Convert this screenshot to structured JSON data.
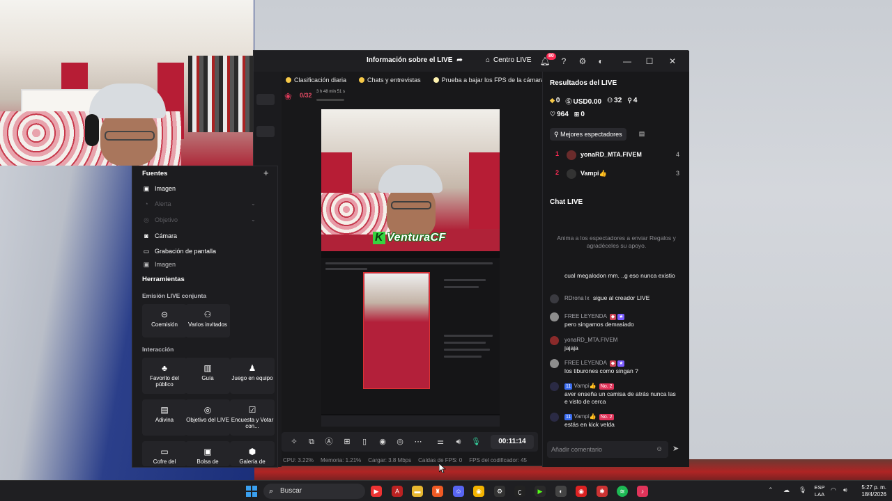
{
  "window": {
    "title": "Información sobre el LIVE",
    "center_label": "Centro LIVE",
    "notif_count": "80"
  },
  "tabs": [
    {
      "label": "Clasificación diaria"
    },
    {
      "label": "Chats y entrevistas"
    },
    {
      "label": "Prueba a bajar los FPS de la cámara"
    }
  ],
  "goal": {
    "count": "0/32",
    "time": "3 h 48 min 51 s"
  },
  "preview": {
    "overlay_text": "VenturaCF",
    "overlay_badge": "K"
  },
  "controls": {
    "timer": "00:11:14"
  },
  "stats": {
    "cpu": "CPU: 3.22%",
    "memory": "Memoria: 1.21%",
    "load": "Cargar: 3.8 Mbps",
    "fps_drop": "Caídas de FPS: 0",
    "encoder_fps": "FPS del codificador: 45"
  },
  "results": {
    "title": "Resultados del LIVE",
    "row1": {
      "diamonds": "0",
      "usd": "USD0.00",
      "viewers": "32",
      "followers": "4"
    },
    "row2": {
      "likes": "964",
      "gifts": "0"
    },
    "top_viewers_label": "Mejores espectadores",
    "ranking": [
      {
        "rank": "1",
        "name": "yonaRD_MTA.FIVEM",
        "score": "4"
      },
      {
        "rank": "2",
        "name": "Vampi👍",
        "score": "3"
      }
    ]
  },
  "chat": {
    "title": "Chat LIVE",
    "hint": "Anima a los espectadores a enviar Regalos y agradéceles su apoyo.",
    "messages": [
      {
        "user": "",
        "text": "cual megalodon mm. ..g eso nunca existio"
      },
      {
        "user": "RDrona lx",
        "text": "sigue al creador LIVE"
      },
      {
        "user": "FREE LEYENDA",
        "text": "pero singamos demasiado"
      },
      {
        "user": "yonaRD_MTA.FIVEM",
        "text": "jajaja"
      },
      {
        "user": "FREE LEYENDA",
        "text": "los tiburones como singan ?"
      },
      {
        "user": "Vampi👍",
        "badge_level": "11",
        "badge_rank": "No. 2",
        "text": "aver enseña un camisa de atrás nunca las e visto de cerca"
      },
      {
        "user": "Vampi👍",
        "badge_level": "11",
        "badge_rank": "No. 2",
        "text": "estás en kick velda"
      }
    ],
    "comment_placeholder": "Añadir comentario"
  },
  "sources": {
    "title": "Fuentes",
    "items": [
      {
        "label": "Imagen",
        "enabled": true
      },
      {
        "label": "Alerta",
        "enabled": false
      },
      {
        "label": "Objetivo",
        "enabled": false
      },
      {
        "label": "Cámara",
        "enabled": true
      },
      {
        "label": "Grabación de pantalla",
        "enabled": true
      },
      {
        "label": "Imagen",
        "enabled": true
      }
    ]
  },
  "tools": {
    "title": "Herramientas",
    "joint_label": "Emisión LIVE conjunta",
    "joint": [
      {
        "label": "Coemisión"
      },
      {
        "label": "Varios invitados"
      }
    ],
    "interaction_label": "Interacción",
    "interaction": [
      {
        "label": "Favorito del público"
      },
      {
        "label": "Guía"
      },
      {
        "label": "Juego en equipo"
      },
      {
        "label": "Adivina"
      },
      {
        "label": "Objetivo del LIVE"
      },
      {
        "label": "Encuesta y Votar con..."
      },
      {
        "label": "Cofre del"
      },
      {
        "label": "Bolsa de"
      },
      {
        "label": "Galería de"
      }
    ]
  },
  "taskbar": {
    "search_label": "Buscar",
    "lang_line1": "ESP",
    "lang_line2": "LAA",
    "time": "5:27 p. m.",
    "date": "18/4/2026"
  }
}
